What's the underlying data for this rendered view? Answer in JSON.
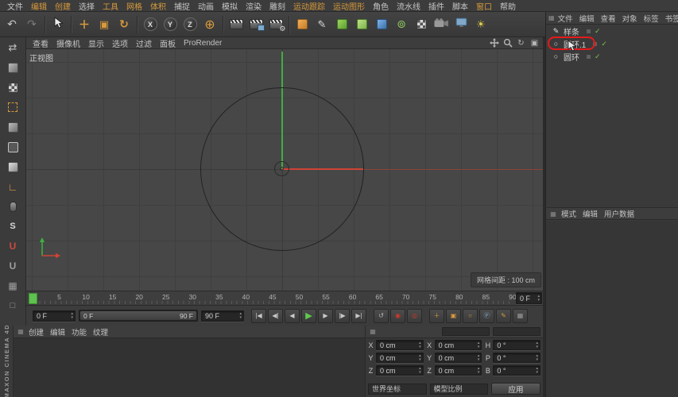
{
  "menubar": {
    "items": [
      {
        "label": "文件",
        "accent": false
      },
      {
        "label": "编辑",
        "accent": true
      },
      {
        "label": "创建",
        "accent": true
      },
      {
        "label": "选择",
        "accent": false
      },
      {
        "label": "工具",
        "accent": true
      },
      {
        "label": "网格",
        "accent": true
      },
      {
        "label": "体积",
        "accent": true
      },
      {
        "label": "捕捉",
        "accent": false
      },
      {
        "label": "动画",
        "accent": false
      },
      {
        "label": "模拟",
        "accent": false
      },
      {
        "label": "渲染",
        "accent": false
      },
      {
        "label": "雕刻",
        "accent": false
      },
      {
        "label": "运动跟踪",
        "accent": true
      },
      {
        "label": "运动图形",
        "accent": true
      },
      {
        "label": "角色",
        "accent": false
      },
      {
        "label": "流水线",
        "accent": false
      },
      {
        "label": "插件",
        "accent": false
      },
      {
        "label": "脚本",
        "accent": false
      },
      {
        "label": "窗口",
        "accent": true
      },
      {
        "label": "帮助",
        "accent": false
      }
    ]
  },
  "toolbar": {
    "icons": [
      {
        "name": "undo",
        "kind": "glyph",
        "glyph": "↶",
        "color": "#c6c6c6",
        "size": 14
      },
      {
        "name": "redo",
        "kind": "glyph",
        "glyph": "↷",
        "color": "#787878",
        "size": 14
      },
      {
        "kind": "sep"
      },
      {
        "name": "live-selection",
        "kind": "cursor"
      },
      {
        "kind": "sep"
      },
      {
        "name": "move-tool",
        "kind": "glyph",
        "glyph": "＋",
        "color": "#d79a3c",
        "size": 14,
        "bold": true
      },
      {
        "name": "scale-tool",
        "kind": "glyph",
        "glyph": "▣",
        "color": "#d79a3c",
        "size": 13
      },
      {
        "name": "rotate-tool",
        "kind": "glyph",
        "glyph": "↻",
        "color": "#d79a3c",
        "size": 14,
        "bold": true
      },
      {
        "kind": "sep"
      },
      {
        "name": "lock-x-axis",
        "kind": "circle-letter",
        "letter": "X"
      },
      {
        "name": "lock-y-axis",
        "kind": "circle-letter",
        "letter": "Y"
      },
      {
        "name": "lock-z-axis",
        "kind": "circle-letter",
        "letter": "Z"
      },
      {
        "name": "coordinate-system",
        "kind": "glyph",
        "glyph": "⊕",
        "color": "#d79a3c",
        "size": 16
      },
      {
        "kind": "sep"
      },
      {
        "name": "render-view",
        "kind": "clapper"
      },
      {
        "name": "render-picture-viewer",
        "kind": "clapper",
        "variant": "pic"
      },
      {
        "name": "render-settings",
        "kind": "clapper",
        "variant": "gear"
      },
      {
        "kind": "sep"
      },
      {
        "name": "add-primitive",
        "kind": "cube",
        "cls": "orange"
      },
      {
        "name": "spline-pen",
        "kind": "glyph",
        "glyph": "✎",
        "color": "#d8d8d8",
        "size": 13
      },
      {
        "name": "volume-builder",
        "kind": "cube",
        "cls": "green"
      },
      {
        "name": "volume-mesher",
        "kind": "cube",
        "cls": "green2"
      },
      {
        "name": "field",
        "kind": "cube",
        "cls": "blue"
      },
      {
        "name": "mograph-cloner",
        "kind": "glyph",
        "glyph": "⊚",
        "color": "#8fc95f",
        "size": 14
      },
      {
        "name": "floor",
        "kind": "checker"
      },
      {
        "name": "camera",
        "kind": "camera"
      },
      {
        "name": "display",
        "kind": "monitor"
      },
      {
        "name": "light",
        "kind": "glyph",
        "glyph": "☀",
        "color": "#e3cf4e",
        "size": 13
      }
    ]
  },
  "left_toolbar": {
    "icons": [
      {
        "name": "make-editable",
        "kind": "glyph",
        "glyph": "⇄",
        "color": "#c0c0c0",
        "size": 13
      },
      {
        "name": "model-mode",
        "kind": "cube",
        "cls": "gray"
      },
      {
        "name": "texture-mode",
        "kind": "checker"
      },
      {
        "name": "workplane-mode",
        "kind": "dotted"
      },
      {
        "name": "points-mode",
        "kind": "cube",
        "cls": "graydots"
      },
      {
        "name": "edges-mode",
        "kind": "cube",
        "cls": "grayline"
      },
      {
        "name": "polygons-mode",
        "kind": "cube",
        "cls": "grayfill"
      },
      {
        "name": "enable-axis",
        "kind": "glyph",
        "glyph": "∟",
        "color": "#d79a3c",
        "size": 13,
        "bold": true
      },
      {
        "name": "viewport-solo",
        "kind": "mouse"
      },
      {
        "name": "snap",
        "kind": "glyph",
        "glyph": "S",
        "color": "#d8d8d8",
        "size": 11,
        "bold": true
      },
      {
        "name": "quantize",
        "kind": "glyph",
        "glyph": "U",
        "color": "#cc4b3d",
        "size": 12,
        "bold": true
      },
      {
        "name": "magnet",
        "kind": "glyph",
        "glyph": "U",
        "color": "#9f9f9f",
        "size": 12,
        "bold": true
      },
      {
        "name": "workplane",
        "kind": "glyph",
        "glyph": "▦",
        "color": "#9f9f9f",
        "size": 12
      },
      {
        "name": "lock-workplane",
        "kind": "glyph",
        "glyph": "□",
        "color": "#9f9f9f",
        "size": 11
      }
    ]
  },
  "viewport": {
    "menu": [
      "查看",
      "摄像机",
      "显示",
      "选项",
      "过滤",
      "面板",
      "ProRender"
    ],
    "view_label": "正视图",
    "grid_label": "网格间距 : 100 cm"
  },
  "timeline": {
    "ticks": [
      5,
      10,
      15,
      20,
      25,
      30,
      35,
      40,
      45,
      50,
      55,
      60,
      65,
      70,
      75,
      80,
      85,
      90
    ],
    "ruler_current": "0 F",
    "play_start": "0 F",
    "play_end": "90 F",
    "range_start": "0 F",
    "range_end": "90 F",
    "transport": [
      {
        "name": "goto-start",
        "glyph": "|◀"
      },
      {
        "name": "prev-key",
        "glyph": "◀|"
      },
      {
        "name": "prev-frame",
        "glyph": "◀"
      },
      {
        "name": "play",
        "glyph": "▶"
      },
      {
        "name": "next-frame",
        "glyph": "▶"
      },
      {
        "name": "next-key",
        "glyph": "|▶"
      },
      {
        "name": "goto-end",
        "glyph": "▶|"
      }
    ],
    "record_circles": [
      {
        "name": "loop",
        "glyph": "↺",
        "color": "#b8b8b8"
      },
      {
        "name": "record-keyframe",
        "glyph": "◉",
        "color": "#d2372b"
      },
      {
        "name": "autokey",
        "glyph": "◎",
        "color": "#d2372b"
      }
    ],
    "record_toggles": [
      {
        "name": "record-position",
        "glyph": "＋",
        "color": "#d79a3c"
      },
      {
        "name": "record-scale",
        "glyph": "▣",
        "color": "#d79a3c"
      },
      {
        "name": "record-rotation",
        "glyph": "○",
        "color": "#d79a3c"
      },
      {
        "name": "record-parameter",
        "glyph": "Ⓟ",
        "color": "#7fa8c9"
      },
      {
        "name": "record-point-level",
        "glyph": "✎",
        "color": "#d79a3c"
      },
      {
        "name": "timeline-options",
        "glyph": "▦",
        "color": "#9a9a9a"
      }
    ]
  },
  "material_manager": {
    "menu": [
      "创建",
      "编辑",
      "功能",
      "纹理"
    ]
  },
  "coordinates": {
    "rows": [
      {
        "cells": [
          {
            "label": "X",
            "value": "0 cm",
            "name": "position-x"
          },
          {
            "label": "X",
            "value": "0 cm",
            "name": "size-x"
          },
          {
            "label": "H",
            "value": "0 °",
            "name": "rotation-h"
          }
        ]
      },
      {
        "cells": [
          {
            "label": "Y",
            "value": "0 cm",
            "name": "position-y"
          },
          {
            "label": "Y",
            "value": "0 cm",
            "name": "size-y"
          },
          {
            "label": "P",
            "value": "0 °",
            "name": "rotation-p"
          }
        ]
      },
      {
        "cells": [
          {
            "label": "Z",
            "value": "0 cm",
            "name": "position-z"
          },
          {
            "label": "Z",
            "value": "0 cm",
            "name": "size-z"
          },
          {
            "label": "B",
            "value": "0 °",
            "name": "rotation-b"
          }
        ]
      }
    ],
    "dropdown_left": "世界坐标",
    "dropdown_right": "模型比例",
    "apply_label": "应用"
  },
  "object_manager": {
    "menu": [
      "文件",
      "编辑",
      "查看",
      "对象",
      "标签",
      "书签"
    ],
    "rows": [
      {
        "name": "样条",
        "icon": "pen",
        "annotated": false
      },
      {
        "name": "圆环.1",
        "icon": "circle",
        "annotated": true
      },
      {
        "name": "圆环",
        "icon": "circle",
        "annotated": false
      }
    ]
  },
  "attribute_manager": {
    "menu": [
      "模式",
      "编辑",
      "用户数据"
    ]
  },
  "branding": "MAXON CINEMA 4D",
  "colors": {
    "accent": "#d79a3c",
    "axis_green": "#3fae3f",
    "axis_red": "#cf4335",
    "check_green": "#7cc24f",
    "annotation_red": "#e41a1a"
  }
}
